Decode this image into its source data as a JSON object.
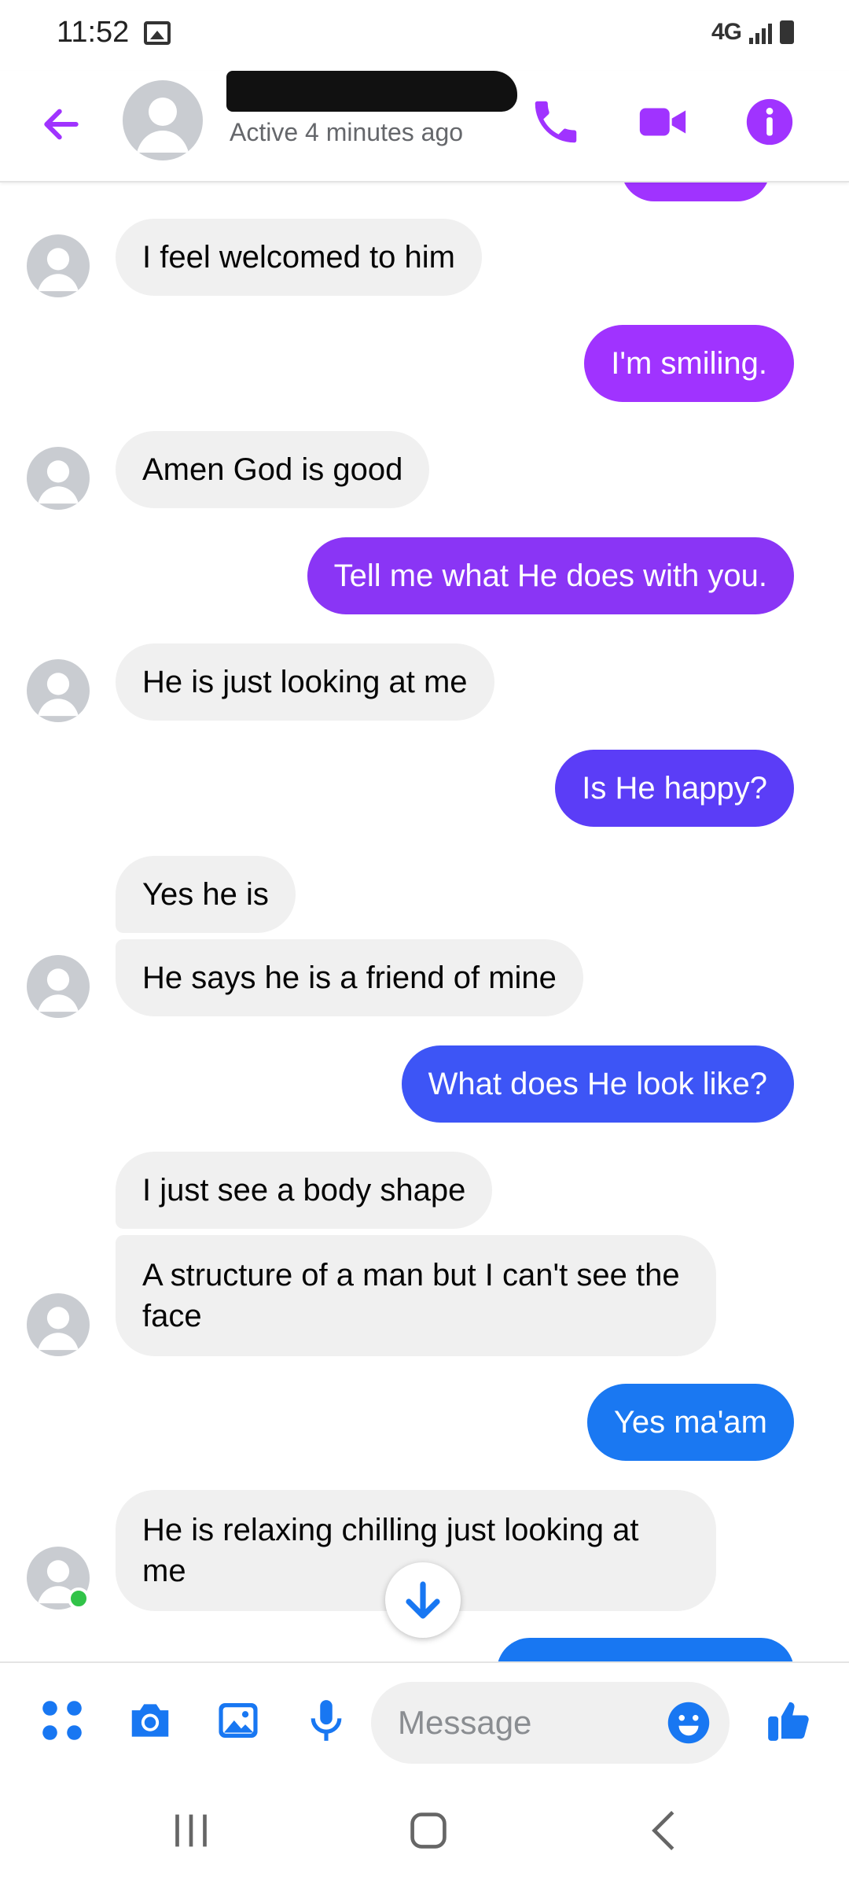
{
  "status_bar": {
    "time": "11:52",
    "network": "4G"
  },
  "header": {
    "back_icon": "arrow-left-icon",
    "contact_name_redacted": true,
    "active_status": "Active 4 minutes ago",
    "actions": [
      "phone-icon",
      "video-camera-icon",
      "info-icon"
    ],
    "accent_color": "#a033ff"
  },
  "messages": [
    {
      "sender": "them",
      "text": "I feel welcomed to him"
    },
    {
      "sender": "me",
      "text": "I'm smiling."
    },
    {
      "sender": "them",
      "text": "Amen God is good"
    },
    {
      "sender": "me",
      "text": "Tell me what He does with you."
    },
    {
      "sender": "them",
      "text": "He is just looking at me"
    },
    {
      "sender": "me",
      "text": "Is He happy?"
    },
    {
      "sender": "them",
      "text": "Yes he is"
    },
    {
      "sender": "them",
      "text": "He says he is a friend of mine"
    },
    {
      "sender": "me",
      "text": "What does He look like?"
    },
    {
      "sender": "them",
      "text": "I just see a body shape"
    },
    {
      "sender": "them",
      "text": "A structure of a man but I can't see the face"
    },
    {
      "sender": "me",
      "text": "Yes ma'am"
    },
    {
      "sender": "them",
      "text": "He is relaxing chilling just looking at me"
    }
  ],
  "gradient_colors": {
    "msg1": "#a033ff",
    "msg3": "#8a35f5",
    "msg5": "#5b3df7",
    "msg8": "#3d55f6",
    "msg11": "#1a78f2"
  },
  "composer": {
    "icons": [
      "apps-grid-icon",
      "camera-icon",
      "gallery-icon",
      "microphone-icon"
    ],
    "placeholder": "Message",
    "emoji_icon": "smiley-icon",
    "send_icon": "thumbs-up-icon",
    "accent_color": "#1877f2"
  },
  "nav_bar": [
    "recent-apps-icon",
    "home-icon",
    "back-icon"
  ]
}
